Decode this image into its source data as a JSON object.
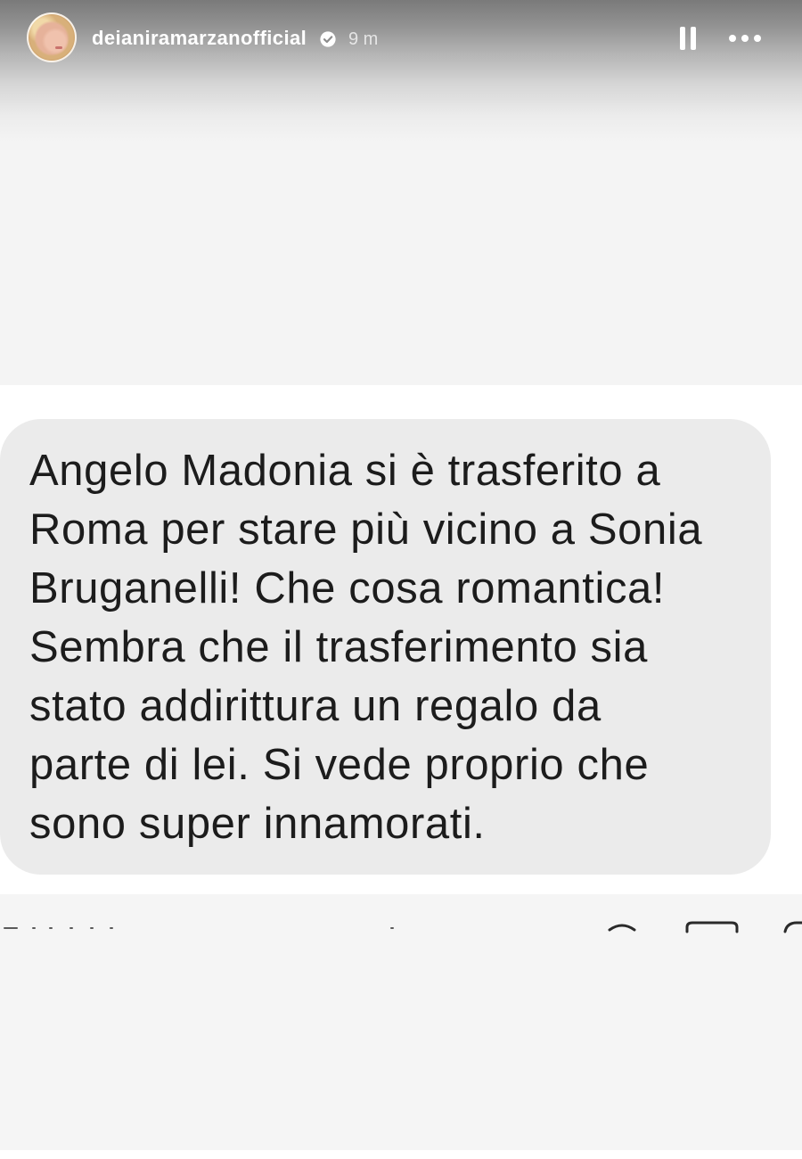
{
  "story": {
    "username": "deianiramarzanofficial",
    "verified": true,
    "verified_icon": "verified-badge-icon",
    "time_ago": "9 m",
    "avatar_icon": "profile-photo"
  },
  "controls": {
    "pause_icon": "pause-icon",
    "more_icon": "more-options-icon"
  },
  "message": {
    "lines": [
      "Angelo Madonia si è trasferito a",
      "Roma per stare più vicino a Sonia",
      "Bruganelli! Che cosa romantica!",
      "Sembra che il trasferimento sia",
      "stato addirittura un regalo da",
      "parte di lei. Si vede proprio che",
      "sono super innamorati."
    ]
  },
  "colors": {
    "background": "#f4f4f4",
    "panel": "#ffffff",
    "bubble": "#ebebeb",
    "message_text": "#1c1c1c",
    "header_text": "#ffffff"
  }
}
